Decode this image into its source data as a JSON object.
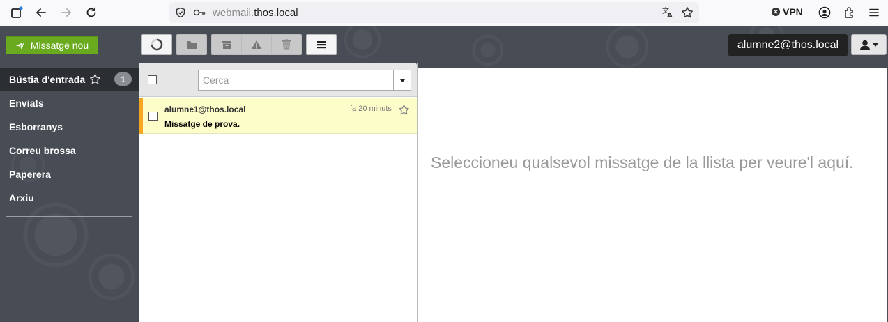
{
  "browser": {
    "url_prefix": "webmail.",
    "url_domain": "thos.local",
    "vpn_label": "VPN"
  },
  "toolbar": {
    "compose_label": "Missatge nou",
    "user_email": "alumne2@thos.local"
  },
  "sidebar": {
    "folders": [
      {
        "label": "Bústia d'entrada",
        "unread": "1"
      },
      {
        "label": "Enviats"
      },
      {
        "label": "Esborranys"
      },
      {
        "label": "Correu brossa"
      },
      {
        "label": "Paperera"
      },
      {
        "label": "Arxiu"
      }
    ]
  },
  "list": {
    "search_placeholder": "Cerca",
    "messages": [
      {
        "from": "alumne1@thos.local",
        "subject": "Missatge de prova.",
        "time": "fa 20 minuts"
      }
    ]
  },
  "preview": {
    "empty_text": "Seleccioneu qualsevol missatge de la llista per veure'l aquí."
  },
  "colors": {
    "compose_green": "#6aaa1e",
    "app_background": "#474c55",
    "unread_row": "#fdfdca",
    "flag_orange": "#f5a623"
  }
}
